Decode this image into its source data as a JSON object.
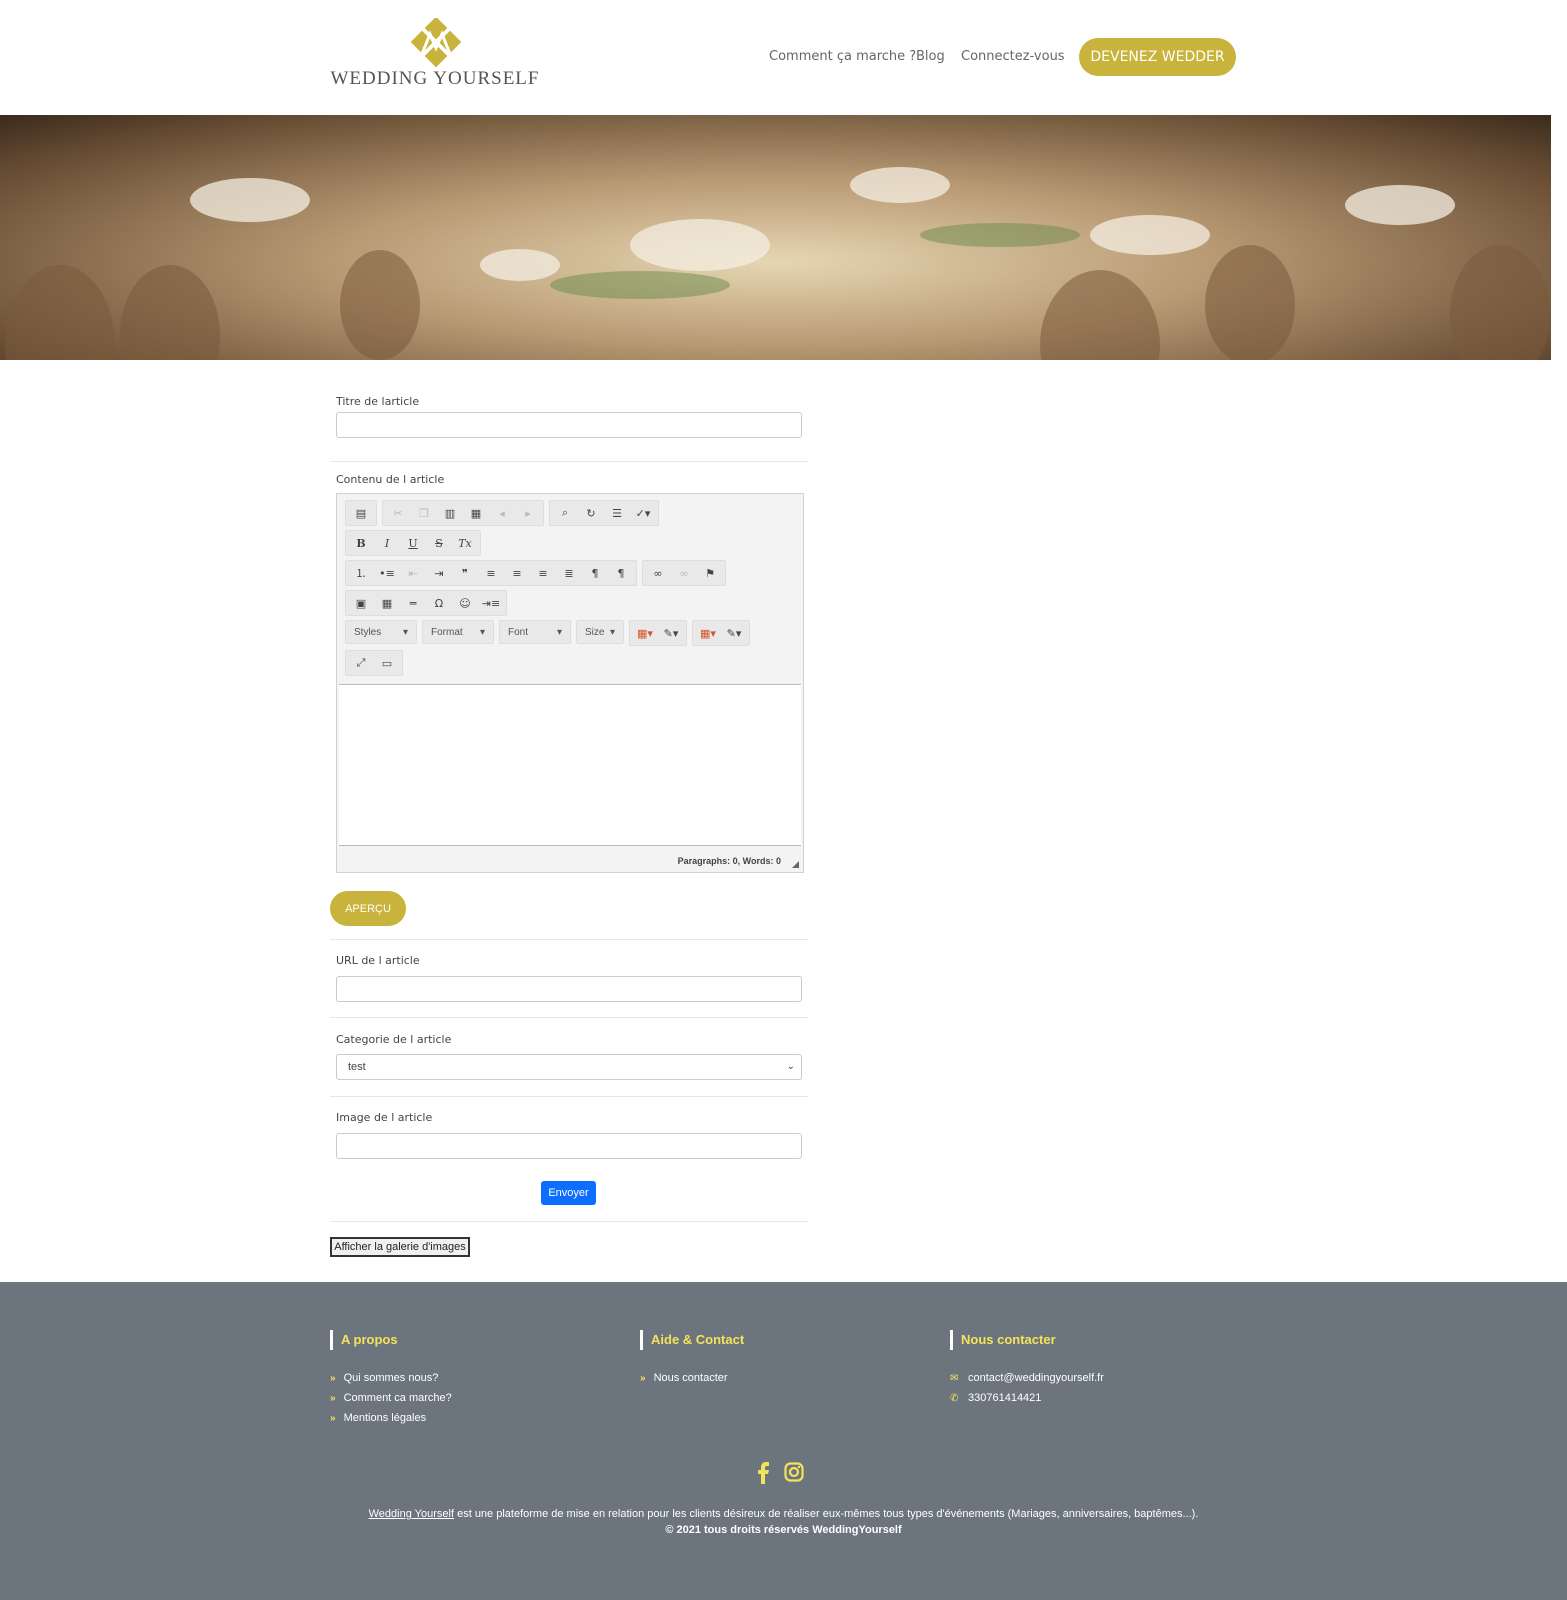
{
  "header": {
    "logo_text": "WEDDING YOURSELF",
    "nav": [
      "Comment ça marche ?",
      "Blog",
      "Connectez-vous"
    ],
    "cta": "DEVENEZ WEDDER"
  },
  "form": {
    "title_label": "Titre de larticle",
    "content_label": "Contenu de l article",
    "editor": {
      "combos": [
        "Styles",
        "Format",
        "Font",
        "Size"
      ],
      "status": "Paragraphs: 0, Words: 0"
    },
    "preview_button": "APERÇU",
    "url_label": "URL de l article",
    "category_label": "Categorie de l article",
    "category_value": "test",
    "image_label": "Image de l article",
    "submit_button": "Envoyer",
    "gallery_button": "Afficher la galerie d'images"
  },
  "footer": {
    "about": {
      "title": "A propos",
      "items": [
        "Qui sommes nous?",
        "Comment ca marche?",
        "Mentions légales"
      ]
    },
    "help": {
      "title": "Aide & Contact",
      "items": [
        "Nous contacter"
      ]
    },
    "contact": {
      "title": "Nous contacter",
      "email": "contact@weddingyourself.fr",
      "phone": "330761414421"
    },
    "desc_link": "Wedding Yourself",
    "desc_text": " est une plateforme de mise en relation pour les clients désireux de réaliser eux-mêmes tous types d'événements (Mariages, anniversaires, baptêmes...).",
    "copyright": "© 2021 tous droits réservés   WeddingYourself"
  },
  "colors": {
    "accent": "#c8b33c",
    "footer_bg": "#6c747e",
    "footer_accent": "#f4e35a",
    "submit": "#0d6efd"
  },
  "icons": [
    "logo-mark",
    "email-icon",
    "phone-icon",
    "facebook-icon",
    "instagram-icon"
  ]
}
